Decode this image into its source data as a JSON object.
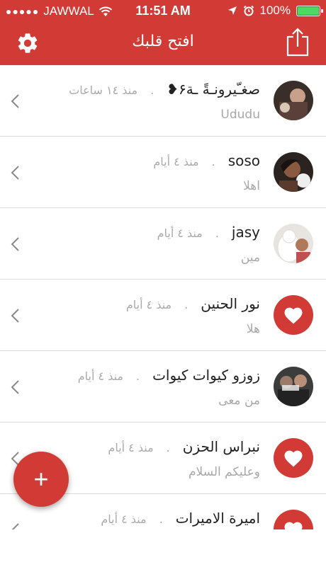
{
  "status_bar": {
    "carrier": "JAWWAL",
    "time": "11:51 AM",
    "battery_percent": "100%",
    "battery_level": 1.0
  },
  "navbar": {
    "title": "افتح قلبك",
    "left_icon": "gear-icon",
    "right_icon": "share-icon"
  },
  "colors": {
    "accent": "#d23a35",
    "secondary_text": "#a8a8a8",
    "separator": "#d9d9d9",
    "battery": "#4cd964"
  },
  "conversations": [
    {
      "name": "صغـّيرونـةً ـة۶❥",
      "dot": ".",
      "time": "منذ ١٤ ساعات",
      "message": "Ududu",
      "avatar": "photo"
    },
    {
      "name": "soso",
      "dot": ".",
      "time": "منذ ٤ أيام",
      "message": "اهلا",
      "avatar": "photo"
    },
    {
      "name": "jasy",
      "dot": ".",
      "time": "منذ ٤ أيام",
      "message": "مين",
      "avatar": "photo"
    },
    {
      "name": "نور الحنين",
      "dot": ".",
      "time": "منذ ٤ أيام",
      "message": "هلا",
      "avatar": "heart"
    },
    {
      "name": "زوزو كيوات كيوات",
      "dot": ".",
      "time": "منذ ٤ أيام",
      "message": "من معى",
      "avatar": "photo"
    },
    {
      "name": "نبراس الحزن",
      "dot": ".",
      "time": "منذ ٤ أيام",
      "message": "وعليكم السلام",
      "avatar": "heart"
    },
    {
      "name": "اميرة الاميرات",
      "dot": ".",
      "time": "منذ ٤ أيام",
      "message": "",
      "avatar": "heart"
    }
  ],
  "fab": {
    "label": "+",
    "icon": "plus-icon"
  }
}
